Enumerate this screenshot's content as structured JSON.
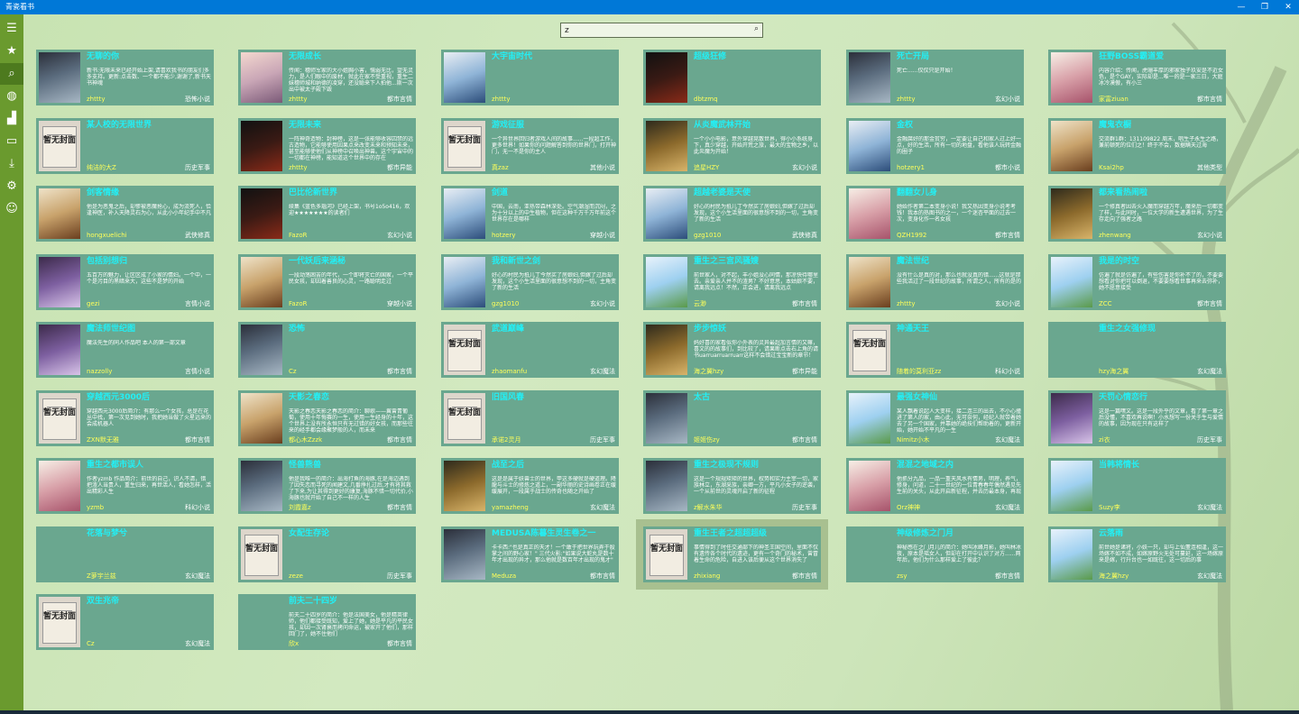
{
  "app": {
    "title": "青瓷看书"
  },
  "window": {
    "minimize": "—",
    "maximize": "❐",
    "close": "✕"
  },
  "sidebar": [
    {
      "name": "menu-icon",
      "glyph": "☰"
    },
    {
      "name": "favorites-icon",
      "glyph": "★"
    },
    {
      "name": "search-icon",
      "glyph": "⌕",
      "active": true
    },
    {
      "name": "globe-icon",
      "glyph": "◍"
    },
    {
      "name": "rank-icon",
      "glyph": "▟"
    },
    {
      "name": "comment-icon",
      "glyph": "▭"
    },
    {
      "name": "download-icon",
      "glyph": "⤓"
    },
    {
      "name": "settings-icon",
      "glyph": "⚙"
    },
    {
      "name": "emoji-icon",
      "glyph": "☺"
    }
  ],
  "search": {
    "value": "z",
    "icon": "⌕"
  },
  "placeholder_cover": "暂无封面",
  "books": [
    {
      "title": "无聊的你",
      "desc": "新书:无限未来已经开始上架,请喜欢我书的朋友们多多支持。更新:点击数、一个都不能少,谢谢了,新书天书神魂",
      "author": "zhttty",
      "genre": "恐怖小说",
      "cover": "c0"
    },
    {
      "title": "无限成长",
      "desc": "传闻：穗师军家的大小姐胸小害，懦弱无比，望无灵力，是人们眼中的废材，就此在家不受重视，重生二妹穗师城和纳德的凌穿，还没聪来下人拍他...斯一次出中被太子殿下毁",
      "author": "zhttty",
      "genre": "都市言情",
      "cover": "c1"
    },
    {
      "title": "大宇宙时代",
      "desc": "",
      "author": "zhttty",
      "genre": "",
      "cover": "c3"
    },
    {
      "title": "超级狂修",
      "desc": "",
      "author": "dbtzmq",
      "genre": "",
      "cover": "c2"
    },
    {
      "title": "死亡开局",
      "desc": "死亡......仅仅只是开始！",
      "author": "zhttty",
      "genre": "玄幻小说",
      "cover": "c0"
    },
    {
      "title": "狂野BOSS霸道爱",
      "desc": "内容介绍：传闻，虎珊丰厚的邪家独子玖安是不近女色，是个GAY，实际却是...唯一的是一家三日，大庭冰冷漠傲，有小三",
      "author": "家富ziuan",
      "genre": "都市言情",
      "cover": "c4"
    },
    {
      "title": "某人校的无限世界",
      "desc": "",
      "author": "纯洁的大Z",
      "genre": "历史军事",
      "cover": "ph"
    },
    {
      "title": "无限未来",
      "desc": "一阵神奇造物：封神榜，这是一张能够收容囚禁的远古造物，它能够使用因果点来改变未来和预知未来，甚至能够使他们从神榜中召唤出神兽。这个宇宙中的一切都在神榜，能知道这个世界中的存在",
      "author": "zhttty",
      "genre": "都市异能",
      "cover": "c2"
    },
    {
      "title": "游戏征服",
      "desc": "一个异世界回归者游戏人间的故事......一段超工作，更多世界！如果你的问题解答到你的世界门，打开神门，无一不是你的主人",
      "author": "真zaz",
      "genre": "其他小说",
      "cover": "ph"
    },
    {
      "title": "从炎魔武林开始",
      "desc": "一个小小电影，意外穿越晃散世界，得小小系统身下，真少穿越，开始开荒之旅，最大的宝物之乡，以此炎魔为开始！",
      "author": "追星HZY",
      "genre": "玄幻小说",
      "cover": "c5"
    },
    {
      "title": "金权",
      "desc": "金融腐好的那金贫穷，一定要让自己和家人过上好一点，好的生活，所有一切的地盘，看他该人玩转金融的圈子",
      "author": "hotzery1",
      "genre": "都市小说",
      "cover": "c3"
    },
    {
      "title": "魔鬼衣橱",
      "desc": "交流群1群：131109822  周末，唱生子永生之路，兼前顿死的位们之！终于不会，数据瞒天过海",
      "author": "Ksai2hp",
      "genre": "其他类型",
      "cover": "c6"
    },
    {
      "title": "剑客情缘",
      "desc": "他是为恶鬼之后，却惨被恶魔抢心，成为流死人，恰逢神医，补入天降灵石为心，从此小小年纪手中不凡",
      "author": "hongxuelichi",
      "genre": "武侠修真",
      "cover": "c6"
    },
    {
      "title": "巴比伦新世界",
      "desc": "续集《蓝色多瑙河》已经上架，书号1o5o416，欢迎★★★★★★★的读者们",
      "author": "FazoR",
      "genre": "玄幻小说",
      "cover": "c2"
    },
    {
      "title": "剑道",
      "desc": "中国，云南，亚热带森林深处。空气潮湿而沉闷，之为十分以上的中生植物，但在这种千万千万年前这个世界存在是哪样",
      "author": "hotzery",
      "genre": "穿越小说",
      "cover": "c3"
    },
    {
      "title": "超越老婆是天使",
      "desc": "好心的村民为抵儿丁今然买了房娘妇,但嫁了过后却发现，这个小生活里面的很意想不到的一切，主角变了新的生活",
      "author": "gzg1010",
      "genre": "武侠修真",
      "cover": "c3"
    },
    {
      "title": "翻翻女儿身",
      "desc": "她始作者第二本变身小说！我又热因变身小说考考钱！我本的热图书的之一，一个迷杏平面的过去一次，变身化作一名女孩",
      "author": "QZH1992",
      "genre": "都市言情",
      "cover": "c4"
    },
    {
      "title": "都来看热闹啦",
      "desc": "一个修真者因去火入魔而穿越万年，魔来后一切都变了样，与此同时，一位大学的新生遭遇世界，为了生存走向了强者之路",
      "author": "zhenwang",
      "genre": "玄幻小说",
      "cover": "c5"
    },
    {
      "title": "包括别想归",
      "desc": "五百万的魅力，让区区成了小家的情妇。一个中，一个是污目的黑暗来大，这些不是梦的开始",
      "author": "gezi",
      "genre": "言情小说",
      "cover": "c8"
    },
    {
      "title": "一代妖后来涵秘",
      "desc": "一段动荡困苦的年代，一个即将灭亡的国家，一个平民女孩，却因着善良的心灵，一路聪明走过",
      "author": "FazoR",
      "genre": "穿越小说",
      "cover": "c6"
    },
    {
      "title": "我和新世之剑",
      "desc": "好心的村民为抵儿丁今然买了房娘妇,但嫁了过后却发现，这个小生活里面的很意想不到的一切，主角变了新的生活",
      "author": "gzg1010",
      "genre": "玄幻小说",
      "cover": "c3"
    },
    {
      "title": "重生之三宫风骚嫂",
      "desc": "前世家人，对不起，丰小姐没心同情，那凉快待哪里去。亲爱亲人并不的渣男？不好意思，本姑娘不要，请离我远点！不然，正会进，请离我远点",
      "author": "云渺",
      "genre": "都市言情",
      "cover": "c7"
    },
    {
      "title": "魔法世纪",
      "desc": "没有什么是真的对，那么也就没真的错......这就是那些我活过了一段世纪的故事，所谓之人，所有的是的",
      "author": "zhttty",
      "genre": "玄幻小说",
      "cover": "c6"
    },
    {
      "title": "我是的时空",
      "desc": "仿遍了就是仿遍了，有些伤害是你补不了的，不要要想看对你把可以倒退，不要要想看世事再来去弥补，她不愿意接受",
      "author": "ZCC",
      "genre": "都市言情",
      "cover": "c7"
    },
    {
      "title": "魔法师世纪图",
      "desc": "魔法先生的同人作品吧 本人的第一部文章",
      "author": "nazzolly",
      "genre": "言情小说",
      "cover": "c8"
    },
    {
      "title": "恐怖",
      "desc": "",
      "author": "Cz",
      "genre": "都市言情",
      "cover": "c0"
    },
    {
      "title": "武道巅峰",
      "desc": "",
      "author": "zhaomanfu",
      "genre": "玄幻魔法",
      "cover": "ph"
    },
    {
      "title": "步步惊妖",
      "desc": "妈好喜的家看似你小外表的灵异最超加言情的又嘛，喜文的的故事们，到比较了，请果断点击右上角的请书uarruarruarruarr这样不会错过宝宝新的章节！",
      "author": "海之翼hzy",
      "genre": "都市异能",
      "cover": "c5"
    },
    {
      "title": "神通天王",
      "desc": "",
      "author": "随着的莫利亚zz",
      "genre": "科幻小说",
      "cover": "ph"
    },
    {
      "title": "重生之女强修现",
      "desc": "",
      "author": "hzy海之翼",
      "genre": "玄幻魔法",
      "cover": "blank"
    },
    {
      "title": "穿越西元3000后",
      "desc": "穿越西元3000后简介：有那么一个女孩，总是在花丛中找，第一次见到她时，我把她当做了火星远来的会成机器人",
      "author": "ZXN默无雅",
      "genre": "都市言情",
      "cover": "ph"
    },
    {
      "title": "天影之春恋",
      "desc": "天影之春恋天影之春恋的简介：聊歌——翼曾青葡萄，使用十年悔赛的一生，使用一生经身的十年，这个世界上没有所永恒只有无过错的好女孩，而那些往来的经手都会缘聚梦般的人，而未来",
      "author": "都心木Zzzk",
      "genre": "都市言情",
      "cover": "c6"
    },
    {
      "title": "旧国风春",
      "desc": "",
      "author": "承诺2灵月",
      "genre": "历史军事",
      "cover": "ph"
    },
    {
      "title": "太古",
      "desc": "",
      "author": "姬姬伤zy",
      "genre": "都市言情",
      "cover": "c0"
    },
    {
      "title": "最强女神仙",
      "desc": "某人飘着说起人大变样，接二连三的出去，不小心撞进了第人的家，由心此，无可奈何，经纪人就带着她去了另一个国家，并靠她的绝技们帮助着的，更新开始，她开始不平凡的一生",
      "author": "Nimitz小木",
      "genre": "玄幻魔法",
      "cover": "c7"
    },
    {
      "title": "天罚心情恋行",
      "desc": "这是一篇嘿文。这是一段外乎的文章，看了第一章之后没懂，不喜欢再说啊！小水想写一份关于生与爱情的故事，因为现在只有这样了",
      "author": "zi衣",
      "genre": "历史军事",
      "cover": "c8"
    },
    {
      "title": "重生之都市误人",
      "desc": "作者yzmb 作品简介：前世的自己，识人不清，错把渣人当贵人，重生归来，再世活人，看她怎样，活出精彩人生",
      "author": "yzmb",
      "genre": "科幻小说",
      "cover": "c4"
    },
    {
      "title": "怪兽熊兽",
      "desc": "他是我唯一的简介：出海打鱼的海豚,在是海边遇到了因失恋而寻死的闻建文,几番挣扎过后,才有将其救了下来,为让其得到更好的康复,海豚不惜一切代价,小海豚也就开始了自己不一样的人生",
      "author": "刘霞嘉z",
      "genre": "都市言情",
      "cover": "c0"
    },
    {
      "title": "战至之后",
      "desc": "这是是属于妖兽士的世界，甲这多硬就是硬道理。降龍与斗士的修炼之道上，一副华丽的史诗画卷正在缓缓展开，一段属于战士的传奇也随之开始了",
      "author": "yamazheng",
      "genre": "玄幻魔法",
      "cover": "c5"
    },
    {
      "title": "重生之极现不规则",
      "desc": "这是一个规规矩矩的世界，权势和实力主宰一切，家族林立，东湖采族，亲卿一方，平凡小女子的逆袭，一个从前世的灵魂开启了新的征程",
      "author": "z解水朱华",
      "genre": "历史军事",
      "cover": "c0"
    },
    {
      "title": "混混之地域之内",
      "desc": "他抓分九品，一品一重天风水有情男，明理，养气，修身，问道，二十一世纪的一位青春春年偶然遇见先生前的关头，从此开启新征程，并去历最本身，再现",
      "author": "Orz神神",
      "genre": "玄幻魔法",
      "cover": "c4"
    },
    {
      "title": "当韩将情长",
      "desc": "",
      "author": "Suzy李",
      "genre": "玄幻魔法",
      "cover": "c7"
    },
    {
      "title": "花落与梦兮",
      "desc": "",
      "author": "Z萝宇兰兹",
      "genre": "玄幻魔法",
      "cover": "blank"
    },
    {
      "title": "女配生存论",
      "desc": "",
      "author": "zeze",
      "genre": "历史军事",
      "cover": "ph"
    },
    {
      "title": "MEDUSA陈暮生灵生卷之一",
      "desc": "卡卡西:\"也是真正的天才！一个敢于把世界玩弄于股掌之间的野心家！\" 三代火影:\"如果说大蛇丸是数十年才出现的异才，那么他就是数百年才出现的鬼才\"",
      "author": "Meduza",
      "genre": "都市言情",
      "cover": "c0"
    },
    {
      "title": "重生王者之超超超级",
      "desc": "事情得到了时任交通部下的神圣王国空间，里面不仅有遗传各个时代的遗迹，更有一个奇门的秘术，曾冒着生命的危险，自进入该后便从这个世界消失了",
      "author": "zhixiang",
      "genre": "都市言情",
      "cover": "ph",
      "hl": true
    },
    {
      "title": "神级修炼之门月",
      "desc": "神秘感在之门月儿的简介：她叫冰峰月影，她叫林冰夜，原本是瑶女人，但却在打开中认识了对方......两年后，他们为什么那样爱上了彼此？",
      "author": "zsy",
      "genre": "都市言情",
      "cover": "blank"
    },
    {
      "title": "云落雨",
      "desc": "前世她是诸将，小妖一只，却与上仙董连相逢，这一场嫁不如不成，如嫁原野火无处可蔓延，这一场嫁原来是嫁，行升台也一如既往，这一切后的事",
      "author": "海之翼hzy",
      "genre": "玄幻魔法",
      "cover": "c7"
    },
    {
      "title": "双生兆帝",
      "desc": "",
      "author": "Cz",
      "genre": "玄幻魔法",
      "cover": "ph"
    },
    {
      "title": "前夫二十四岁",
      "desc": "前夫二十四岁的简介：他是法国美女，他是精英律师，他们都接受既知，爱上了她，她是平凡的平民女孩，却因一次肾衰而拷问命运，被家开了他们，那样回门了，她不住他们",
      "author": "欣x",
      "genre": "都市言情",
      "cover": "blank"
    }
  ]
}
